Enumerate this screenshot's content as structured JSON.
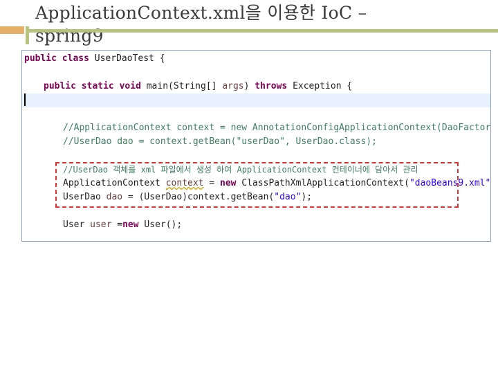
{
  "slide": {
    "title_line1": "ApplicationContext.xml을 이용한 IoC –",
    "title_line2": "spring9"
  },
  "code": {
    "l1": [
      "public",
      " ",
      "class",
      " User",
      "DaoTest {"
    ],
    "l2": [
      "public",
      " ",
      "static",
      " ",
      "void",
      " main(String[] ",
      "args",
      ") ",
      "throws",
      " Exception {"
    ],
    "l4": "//ApplicationContext context = new AnnotationConfigApplicationContext(DaoFactory.class);",
    "l5": "//UserDao dao = context.getBean(\"userDao\", UserDao.class);",
    "l6": "//UserDao 객체를 xml 파일에서 생성 하여 ApplicationContext 컨테이너에 담아서 관리",
    "l7": [
      "ApplicationContext ",
      "context",
      " = ",
      "new",
      " ClassPathXmlApplicationContext(",
      "\"daoBeans9.xml\"",
      ");"
    ],
    "l8": [
      "UserDao ",
      "dao",
      " = (UserDao)context.getBean(",
      "\"dao\"",
      ");"
    ],
    "l9": [
      "User ",
      "user",
      " =",
      "new",
      " User();"
    ]
  }
}
